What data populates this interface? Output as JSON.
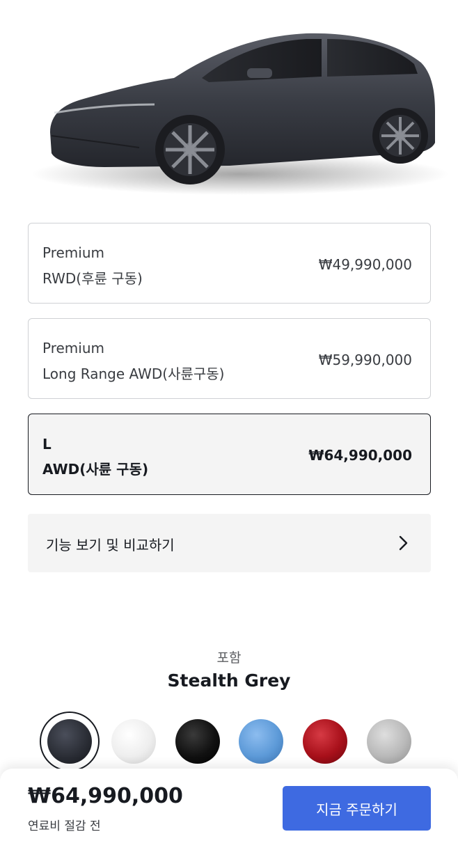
{
  "hero": {
    "image": "grey-suv-side-view"
  },
  "trims": [
    {
      "title": "Premium",
      "drive": "RWD(후륜 구동)",
      "price": "₩49,990,000",
      "selected": false
    },
    {
      "title": "Premium",
      "drive": "Long Range AWD(사륜구동)",
      "price": "₩59,990,000",
      "selected": false
    },
    {
      "title": "L",
      "drive": "AWD(사륜 구동)",
      "price": "₩64,990,000",
      "selected": true
    }
  ],
  "compare": {
    "label": "기능 보기 및 비교하기",
    "icon": "chevron-right-icon"
  },
  "paint": {
    "caption": "포함",
    "name": "Stealth Grey",
    "swatches": [
      {
        "name": "stealth-grey",
        "color": "#2b2e36",
        "selected": true
      },
      {
        "name": "white",
        "color": "#eeeeee",
        "selected": false
      },
      {
        "name": "black",
        "color": "#111111",
        "selected": false
      },
      {
        "name": "blue",
        "color": "#5d9ad8",
        "selected": false
      },
      {
        "name": "red",
        "color": "#a8101a",
        "selected": false
      },
      {
        "name": "silver",
        "color": "#b9b9b9",
        "selected": false
      }
    ]
  },
  "footer": {
    "price": "₩64,990,000",
    "note": "연료비 절감 전",
    "order_label": "지금 주문하기",
    "accent": "#3e6ae1"
  }
}
